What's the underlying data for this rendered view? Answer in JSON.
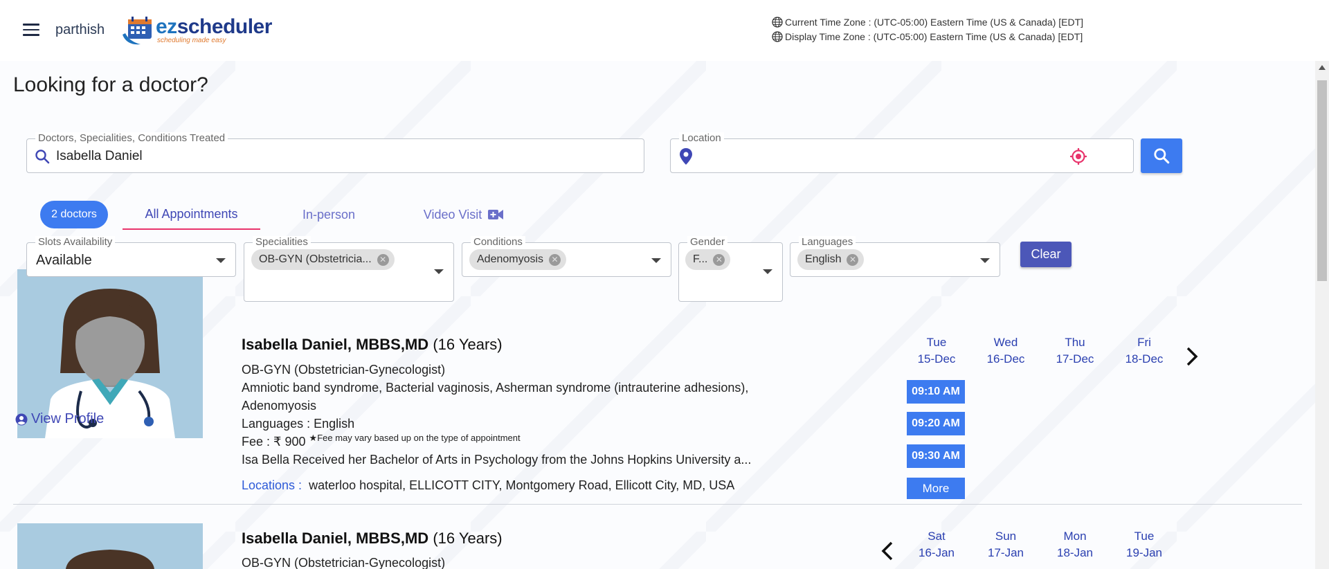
{
  "header": {
    "username": "parthish",
    "logo_text_ez": "ez",
    "logo_text_rest": "scheduler",
    "logo_tagline": "scheduling made easy",
    "current_tz": "Current Time Zone : (UTC-05:00) Eastern Time (US & Canada) [EDT]",
    "display_tz": "Display Time Zone : (UTC-05:00) Eastern Time (US & Canada) [EDT]"
  },
  "page": {
    "title": "Looking for a doctor?"
  },
  "search": {
    "label": "Doctors, Specialities, Conditions Treated",
    "value": "Isabella Daniel",
    "location_label": "Location",
    "location_value": ""
  },
  "tabs": {
    "count": "2 doctors",
    "all": "All Appointments",
    "inperson": "In-person",
    "video": "Video Visit"
  },
  "filters": {
    "slots_label": "Slots Availability",
    "slots_value": "Available",
    "spec_label": "Specialities",
    "spec_chip": "OB-GYN (Obstetricia...",
    "cond_label": "Conditions",
    "cond_chip": "Adenomyosis",
    "gender_label": "Gender",
    "gender_chip": "F...",
    "lang_label": "Languages",
    "lang_chip": "English",
    "clear": "Clear"
  },
  "doctors": [
    {
      "name": "Isabella Daniel, MBBS,MD",
      "experience": "(16 Years)",
      "speciality": "OB-GYN (Obstetrician-Gynecologist)",
      "conditions_1": "Amniotic band syndrome, Bacterial vaginosis, Asherman syndrome (intrauterine adhesions),",
      "conditions_2": "Adenomyosis",
      "languages": "Languages : English",
      "fee": "Fee : ₹ 900",
      "fee_note": "Fee may vary based up on the type of appointment",
      "bio": "Isa Bella Received her Bachelor of Arts in Psychology from the Johns Hopkins University a...",
      "locations_label": "Locations :",
      "locations": "waterloo hospital, ELLICOTT CITY, Montgomery Road, Ellicott City, MD, USA",
      "view_profile": "View Profile",
      "days": [
        {
          "dow": "Tue",
          "date": "15-Dec"
        },
        {
          "dow": "Wed",
          "date": "16-Dec"
        },
        {
          "dow": "Thu",
          "date": "17-Dec"
        },
        {
          "dow": "Fri",
          "date": "18-Dec"
        }
      ],
      "slots": [
        "09:10 AM",
        "09:20 AM",
        "09:30 AM"
      ],
      "more": "More"
    },
    {
      "name": "Isabella Daniel, MBBS,MD",
      "experience": "(16 Years)",
      "speciality": "OB-GYN (Obstetrician-Gynecologist)",
      "days": [
        {
          "dow": "Sat",
          "date": "16-Jan"
        },
        {
          "dow": "Sun",
          "date": "17-Jan"
        },
        {
          "dow": "Mon",
          "date": "18-Jan"
        },
        {
          "dow": "Tue",
          "date": "19-Jan"
        }
      ]
    }
  ],
  "colors": {
    "primary": "#3d7bf0",
    "indigo": "#4c57b8",
    "tab_underline": "#e8336b",
    "location_target": "#e8336b"
  }
}
